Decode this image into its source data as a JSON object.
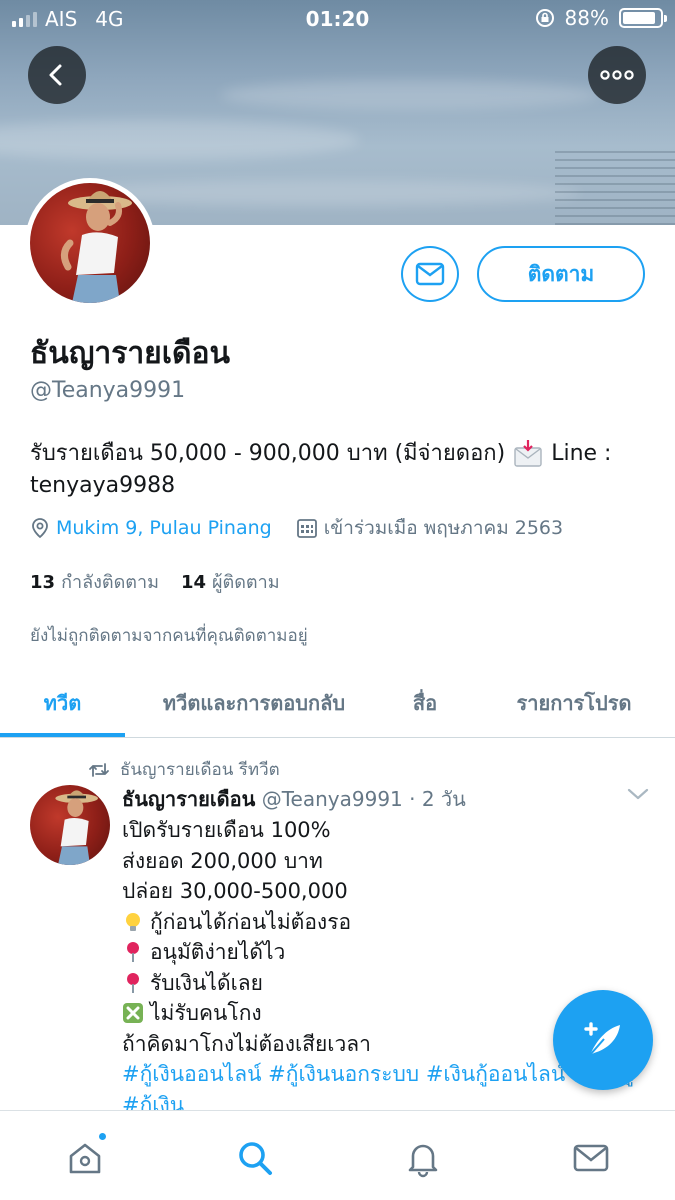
{
  "status_bar": {
    "carrier": "AIS",
    "network": "4G",
    "time": "01:20",
    "battery": "88%"
  },
  "profile": {
    "name": "ธันญารายเดือน",
    "handle": "@Teanya9991",
    "bio_line1": "รับรายเดือน 50,000 - 900,000 บาท (มีจ่ายดอก)",
    "bio_line1_end": "Line :",
    "bio_line2": "tenyaya9988",
    "location": "Mukim 9, Pulau Pinang",
    "joined": "เข้าร่วมเมือ พฤษภาคม 2563",
    "following_count": "13",
    "following_label": "กำลังติดตาม",
    "followers_count": "14",
    "followers_label": "ผู้ติดตาม",
    "not_followed_note": "ยังไม่ถูกติดตามจากคนที่คุณติดตามอยู่",
    "follow_button": "ติดตาม"
  },
  "tabs": [
    {
      "label": "ทวีต",
      "active": true
    },
    {
      "label": "ทวีตและการตอบกลับ",
      "active": false
    },
    {
      "label": "สื่อ",
      "active": false
    },
    {
      "label": "รายการโปรด",
      "active": false
    }
  ],
  "tweet": {
    "retweet_label": "ธันญารายเดือน รีทวีต",
    "author_name": "ธันญารายเดือน",
    "author_handle": "@Teanya9991",
    "time_ago": "· 2 วัน",
    "lines": [
      {
        "text": "เปิดรับรายเดือน 100%",
        "icon": ""
      },
      {
        "text": "ส่งยอด 200,000 บาท",
        "icon": ""
      },
      {
        "text": "ปล่อย 30,000-500,000",
        "icon": ""
      },
      {
        "text": "กู้ก่อนได้ก่อนไม่ต้องรอ",
        "icon": "light-bulb-icon"
      },
      {
        "text": "อนุมัติง่ายได้ไว",
        "icon": "red-pin-icon"
      },
      {
        "text": "รับเงินได้เลย",
        "icon": "red-pin-icon"
      },
      {
        "text": "ไม่รับคนโกง",
        "icon": "cross-mark-icon"
      },
      {
        "text": "ถ้าคิดมาโกงไม่ต้องเสียเวลา",
        "icon": ""
      }
    ],
    "hashtags": "#กู้เงินออนไลน์ #กู้เงินนอกระบบ #เงินกู้ออนไลน์ #เงินกู้ #กู้เงิน"
  },
  "colors": {
    "accent": "#1da1f2",
    "text": "#14171a",
    "secondary": "#657786"
  }
}
